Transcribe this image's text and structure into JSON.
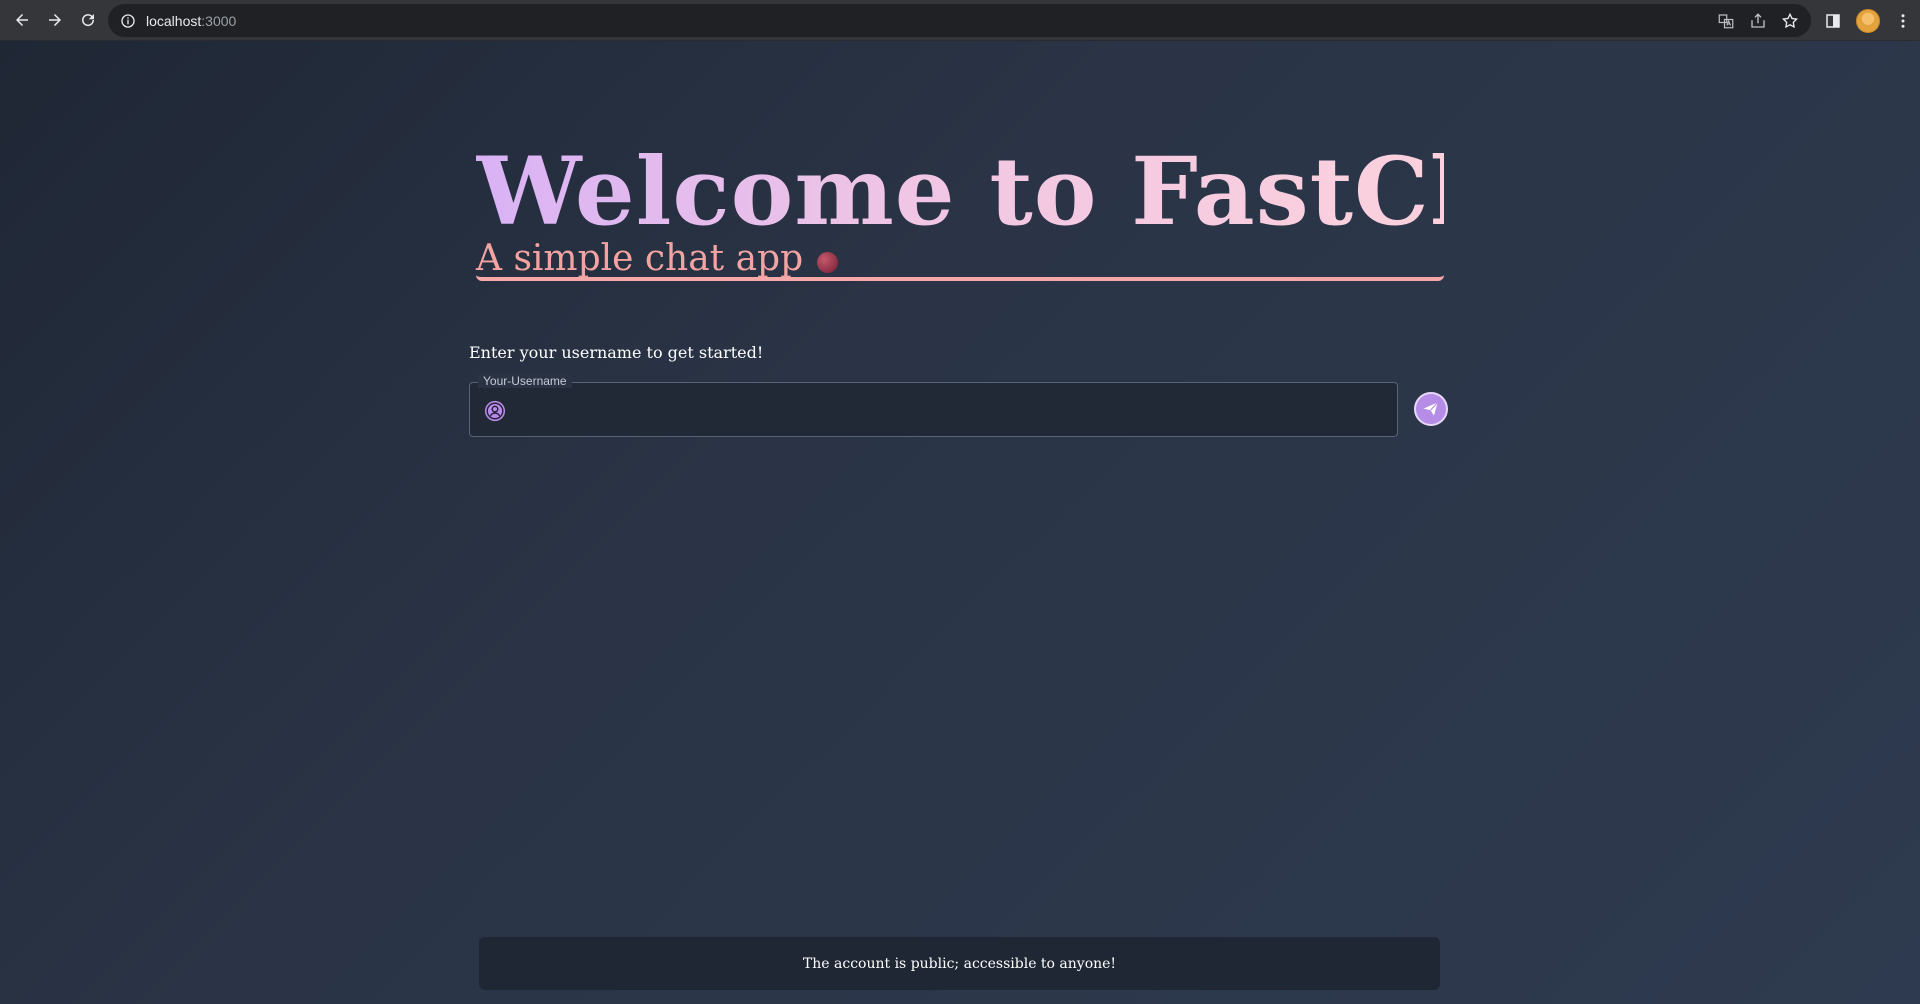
{
  "browser": {
    "url_host": "localhost",
    "url_port": ":3000",
    "icons": [
      "back-icon",
      "forward-icon",
      "reload-icon",
      "info-icon",
      "translate-icon",
      "share-icon",
      "star-icon",
      "side-panel-icon",
      "profile-avatar",
      "more-menu-icon"
    ]
  },
  "hero": {
    "title": "Welcome to FastChat",
    "subtitle": "A simple chat app"
  },
  "login": {
    "prompt": "Enter your username to get started!",
    "field_label": "Your-Username",
    "field_value": "",
    "field_placeholder": ""
  },
  "footer": {
    "notice": "The account is public; accessible to anyone!"
  },
  "colors": {
    "accent": "#b58ce6",
    "title_gradient_start": "#d9b2f5",
    "title_gradient_end": "#fcd1dd",
    "subtitle": "#f4a3a3",
    "background": "#2b3547"
  }
}
